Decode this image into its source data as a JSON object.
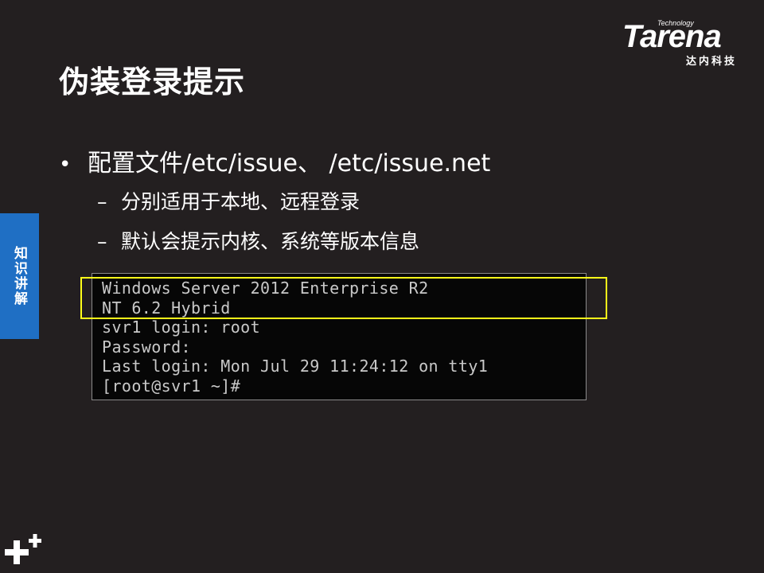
{
  "slide": {
    "title": "伪装登录提示"
  },
  "logo": {
    "tech_label": "Technology",
    "brand": "Tarena",
    "cn_label": "达内科技"
  },
  "side_tab": {
    "label": "知识讲解",
    "color": "#1f6fc4"
  },
  "bullets": {
    "main": {
      "marker": "•",
      "text": "配置文件/etc/issue、 /etc/issue.net"
    },
    "sub": [
      {
        "marker": "–",
        "text": "分别适用于本地、远程登录"
      },
      {
        "marker": "–",
        "text": "默认会提示内核、系统等版本信息"
      }
    ]
  },
  "terminal": {
    "lines": [
      "Windows Server 2012 Enterprise R2",
      "NT 6.2 Hybrid",
      "svr1 login: root",
      "Password:",
      "Last login: Mon Jul 29 11:24:12 on tty1",
      "[root@svr1 ~]#"
    ],
    "highlight_color": "#ffff19"
  },
  "footer": {
    "icon": "plus-icon"
  }
}
